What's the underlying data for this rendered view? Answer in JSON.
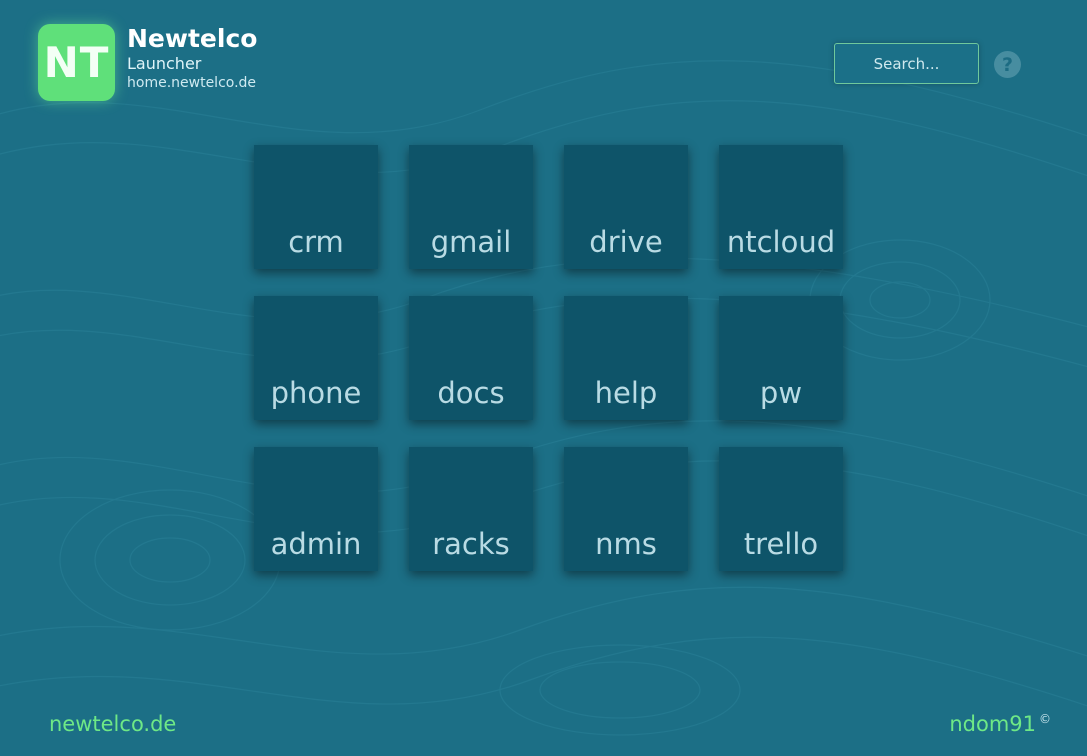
{
  "header": {
    "logo_text": "NT",
    "brand_name": "Newtelco",
    "brand_sub": "Launcher",
    "brand_host": "home.newtelco.de",
    "search_placeholder": "Search...",
    "help_glyph": "?"
  },
  "tiles": [
    {
      "label": "crm"
    },
    {
      "label": "gmail"
    },
    {
      "label": "drive"
    },
    {
      "label": "ntcloud"
    },
    {
      "label": "phone"
    },
    {
      "label": "docs"
    },
    {
      "label": "help"
    },
    {
      "label": "pw"
    },
    {
      "label": "admin"
    },
    {
      "label": "racks"
    },
    {
      "label": "nms"
    },
    {
      "label": "trello"
    }
  ],
  "footer": {
    "left_link": "newtelco.de",
    "right_text": "ndom91",
    "copyright_symbol": "©"
  },
  "colors": {
    "background": "#1c6f86",
    "tile": "#0e5469",
    "accent_green": "#5fe07a",
    "link_green": "#6ee886"
  }
}
